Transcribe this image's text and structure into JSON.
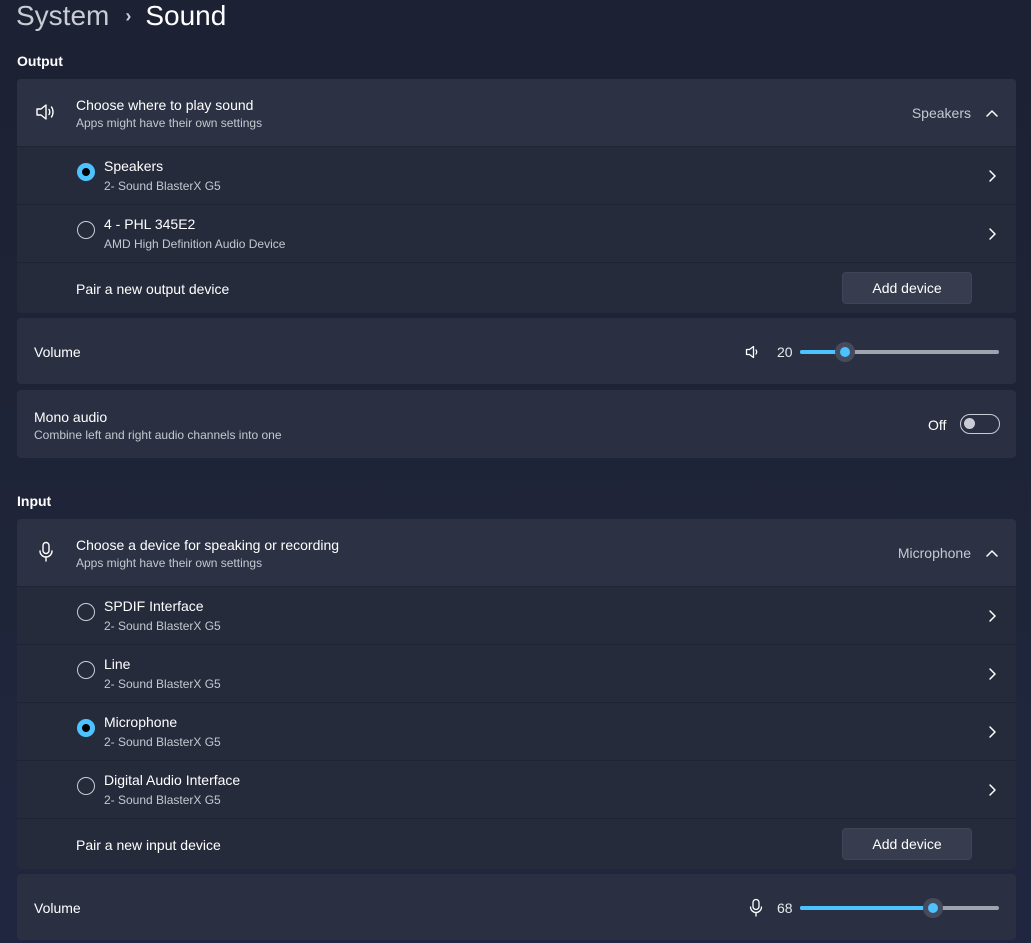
{
  "breadcrumb": {
    "parent": "System",
    "separator": "›",
    "current": "Sound"
  },
  "output": {
    "section_title": "Output",
    "chooser": {
      "title": "Choose where to play sound",
      "subtitle": "Apps might have their own settings",
      "selected_value": "Speakers",
      "icon": "speaker-icon"
    },
    "devices": [
      {
        "name": "Speakers",
        "sub": "2- Sound BlasterX G5",
        "selected": true
      },
      {
        "name": "4 - PHL 345E2",
        "sub": "AMD High Definition Audio Device",
        "selected": false
      }
    ],
    "pair_label": "Pair a new output device",
    "add_button": "Add device",
    "volume": {
      "label": "Volume",
      "value": "20",
      "icon": "speaker-icon"
    },
    "mono": {
      "title": "Mono audio",
      "subtitle": "Combine left and right audio channels into one",
      "state_label": "Off"
    }
  },
  "input": {
    "section_title": "Input",
    "chooser": {
      "title": "Choose a device for speaking or recording",
      "subtitle": "Apps might have their own settings",
      "selected_value": "Microphone",
      "icon": "microphone-icon"
    },
    "devices": [
      {
        "name": "SPDIF Interface",
        "sub": "2- Sound BlasterX G5",
        "selected": false
      },
      {
        "name": "Line",
        "sub": "2- Sound BlasterX G5",
        "selected": false
      },
      {
        "name": "Microphone",
        "sub": "2- Sound BlasterX G5",
        "selected": true
      },
      {
        "name": "Digital Audio Interface",
        "sub": "2- Sound BlasterX G5",
        "selected": false
      }
    ],
    "pair_label": "Pair a new input device",
    "add_button": "Add device",
    "volume": {
      "label": "Volume",
      "value": "68",
      "icon": "microphone-icon"
    }
  },
  "colors": {
    "accent": "#4cc2ff",
    "card": "#2a3042",
    "background": "#1d2232"
  }
}
